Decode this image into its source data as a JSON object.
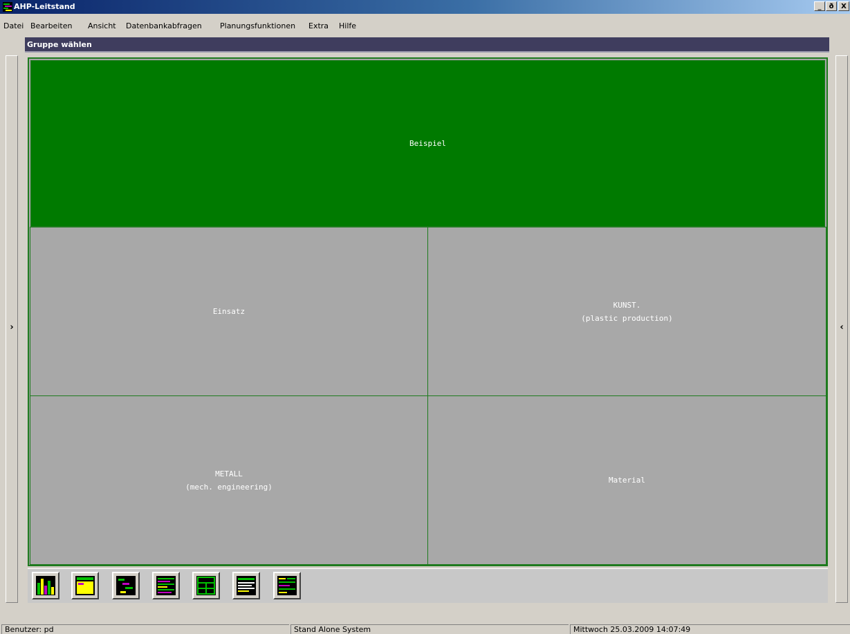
{
  "window": {
    "title": "AHP-Leitstand",
    "controls": {
      "minimize": "_",
      "restore": "ð",
      "close": "X"
    }
  },
  "menu": [
    "Datei",
    "Bearbeiten",
    "Ansicht",
    "Datenbankabfragen",
    "Planungsfunktionen",
    "Extra",
    "Hilfe"
  ],
  "group_header": "Gruppe wählen",
  "side_toggles": {
    "left": "›",
    "right": "‹"
  },
  "tiles": [
    {
      "lines": [
        "Beispiel"
      ],
      "selected": true
    },
    {
      "lines": [
        "Einsatz"
      ],
      "selected": false
    },
    {
      "lines": [
        "KUNST.",
        "(plastic production)"
      ],
      "selected": false
    },
    {
      "lines": [
        "METALL",
        "(mech. engineering)"
      ],
      "selected": false
    },
    {
      "lines": [
        "Material"
      ],
      "selected": false
    }
  ],
  "toolbar": {
    "buttons": [
      {
        "icon": "bar-chart-icon"
      },
      {
        "icon": "yellow-panel-icon"
      },
      {
        "icon": "gantt-icon"
      },
      {
        "icon": "striped-list-icon"
      },
      {
        "icon": "table-grid-icon"
      },
      {
        "icon": "text-document-icon"
      },
      {
        "icon": "task-list-icon"
      }
    ]
  },
  "status": {
    "user": "Benutzer: pd",
    "mode": "Stand Alone System",
    "datetime": "Mittwoch 25.03.2009 14:07:49"
  },
  "colors": {
    "title_active": "#0a246a",
    "selected_tile": "#007a00",
    "tile": "#a8a8a8",
    "grid_line": "#1e7a1e",
    "group_header": "#3f3d5e"
  }
}
